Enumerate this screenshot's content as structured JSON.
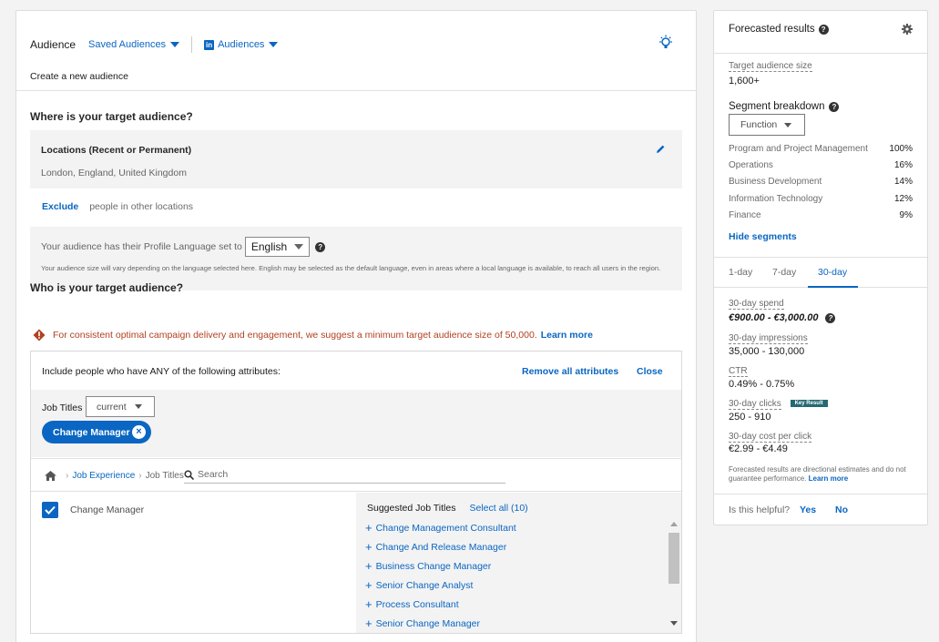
{
  "header": {
    "title": "Audience",
    "saved_audiences": "Saved Audiences",
    "audiences": "Audiences",
    "linkedin_logo": "in",
    "subtitle": "Create a new audience"
  },
  "location_section": {
    "title": "Where is your target audience?",
    "locations_label": "Locations (Recent or Permanent)",
    "locations_value": "London, England, United Kingdom",
    "exclude_link": "Exclude",
    "exclude_text": "people in other locations",
    "language_prefix": "Your audience has their Profile Language set to",
    "language_value": "English",
    "language_note": "Your audience size will vary depending on the language selected here. English may be selected as the default language, even in areas where a local language is available, to reach all users in the region."
  },
  "who_section": {
    "title": "Who is your target audience?",
    "warning": "For consistent optimal campaign delivery and engagement, we suggest a minimum target audience size of 50,000.",
    "learn_more": "Learn more",
    "include_text": "Include people who have ANY of the following attributes:",
    "remove_all": "Remove all attributes",
    "close": "Close",
    "job_titles_label": "Job Titles",
    "job_titles_filter": "current",
    "chip_label": "Change Manager",
    "breadcrumb": [
      "Job Experience",
      "Job Titles"
    ],
    "search_placeholder": "Search",
    "selected_item": "Change Manager",
    "suggested_title": "Suggested Job Titles",
    "select_all": "Select all (10)",
    "suggestions": [
      "Change Management Consultant",
      "Change And Release Manager",
      "Business Change Manager",
      "Senior Change Analyst",
      "Process Consultant",
      "Senior Change Manager"
    ]
  },
  "forecast": {
    "title": "Forecasted results",
    "target_size_label": "Target audience size",
    "target_size_value": "1,600+",
    "segment_title": "Segment breakdown",
    "segment_select": "Function",
    "segments": [
      {
        "name": "Program and Project Management",
        "pct": "100%"
      },
      {
        "name": "Operations",
        "pct": "16%"
      },
      {
        "name": "Business Development",
        "pct": "14%"
      },
      {
        "name": "Information Technology",
        "pct": "12%"
      },
      {
        "name": "Finance",
        "pct": "9%"
      }
    ],
    "hide_segments": "Hide segments",
    "tabs": [
      "1-day",
      "7-day",
      "30-day"
    ],
    "active_tab": "30-day",
    "metrics": {
      "spend_label": "30-day spend",
      "spend_value": "€900.00 - €3,000.00",
      "impressions_label": "30-day impressions",
      "impressions_value": "35,000 - 130,000",
      "ctr_label": "CTR",
      "ctr_value": "0.49% - 0.75%",
      "clicks_label": "30-day clicks",
      "clicks_badge": "Key Result",
      "clicks_value": "250 - 910",
      "cpc_label": "30-day cost per click",
      "cpc_value": "€2.99 - €4.49"
    },
    "fine_print": "Forecasted results are directional estimates and do not guarantee performance.",
    "fine_link": "Learn more",
    "helpful_q": "Is this helpful?",
    "helpful_yes": "Yes",
    "helpful_no": "No"
  },
  "colors": {
    "link_blue": "#0a66c2",
    "warning": "#b24020",
    "badge": "#246a73"
  }
}
